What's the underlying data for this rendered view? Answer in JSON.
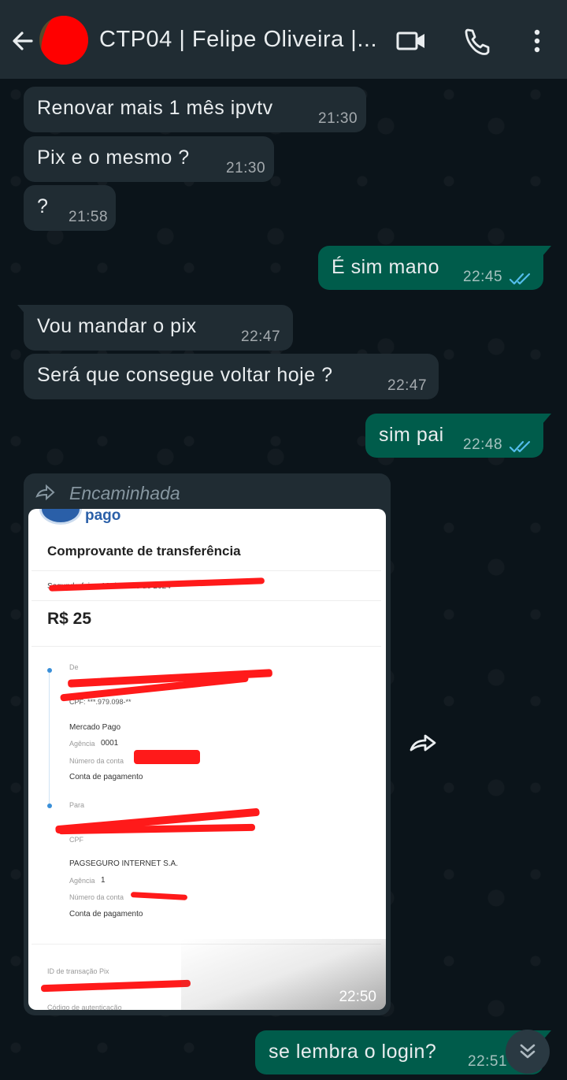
{
  "header": {
    "title": "CTP04 | Felipe Oliveira |..."
  },
  "messages": [
    {
      "dir": "in",
      "text": "Renovar mais 1 mês ipvtv",
      "time": "21:30"
    },
    {
      "dir": "in",
      "text": "Pix e o mesmo ?",
      "time": "21:30"
    },
    {
      "dir": "in",
      "text": "?",
      "time": "21:58"
    },
    {
      "dir": "out",
      "text": "É sim mano",
      "time": "22:45"
    },
    {
      "dir": "in",
      "text": "Vou mandar o pix",
      "time": "22:47"
    },
    {
      "dir": "in",
      "text": "Será que consegue voltar hoje ?",
      "time": "22:47"
    },
    {
      "dir": "out",
      "text": "sim pai",
      "time": "22:48"
    },
    {
      "dir": "out",
      "text": "se lembra o login?",
      "time": "22:51"
    }
  ],
  "forwarded": {
    "label": "Encaminhada",
    "time": "22:50",
    "receipt": {
      "brand": "pago",
      "title": "Comprovante de transferência",
      "date": "Segunda-feira, 13 de Maio de 2024",
      "amount": "R$ 25",
      "from_label": "De",
      "from_cpf": "CPF: ***.979.098-**",
      "from_bank": "Mercado Pago",
      "from_agency_label": "Agência",
      "from_agency": "0001",
      "from_account_label": "Número da conta",
      "from_account_type": "Conta de pagamento",
      "to_label": "Para",
      "to_cpf_label": "CPF",
      "to_bank": "PAGSEGURO INTERNET S.A.",
      "to_agency_label": "Agência",
      "to_agency": "1",
      "to_account_label": "Número da conta",
      "to_account_type": "Conta de pagamento",
      "txid_label": "ID de transação Pix",
      "auth_label": "Código de autenticação"
    }
  },
  "colors": {
    "header_bg": "#202c33",
    "incoming_bubble": "#202c33",
    "outgoing_bubble": "#005c4b",
    "tick_blue": "#53bdeb",
    "redaction": "#ff0000"
  }
}
